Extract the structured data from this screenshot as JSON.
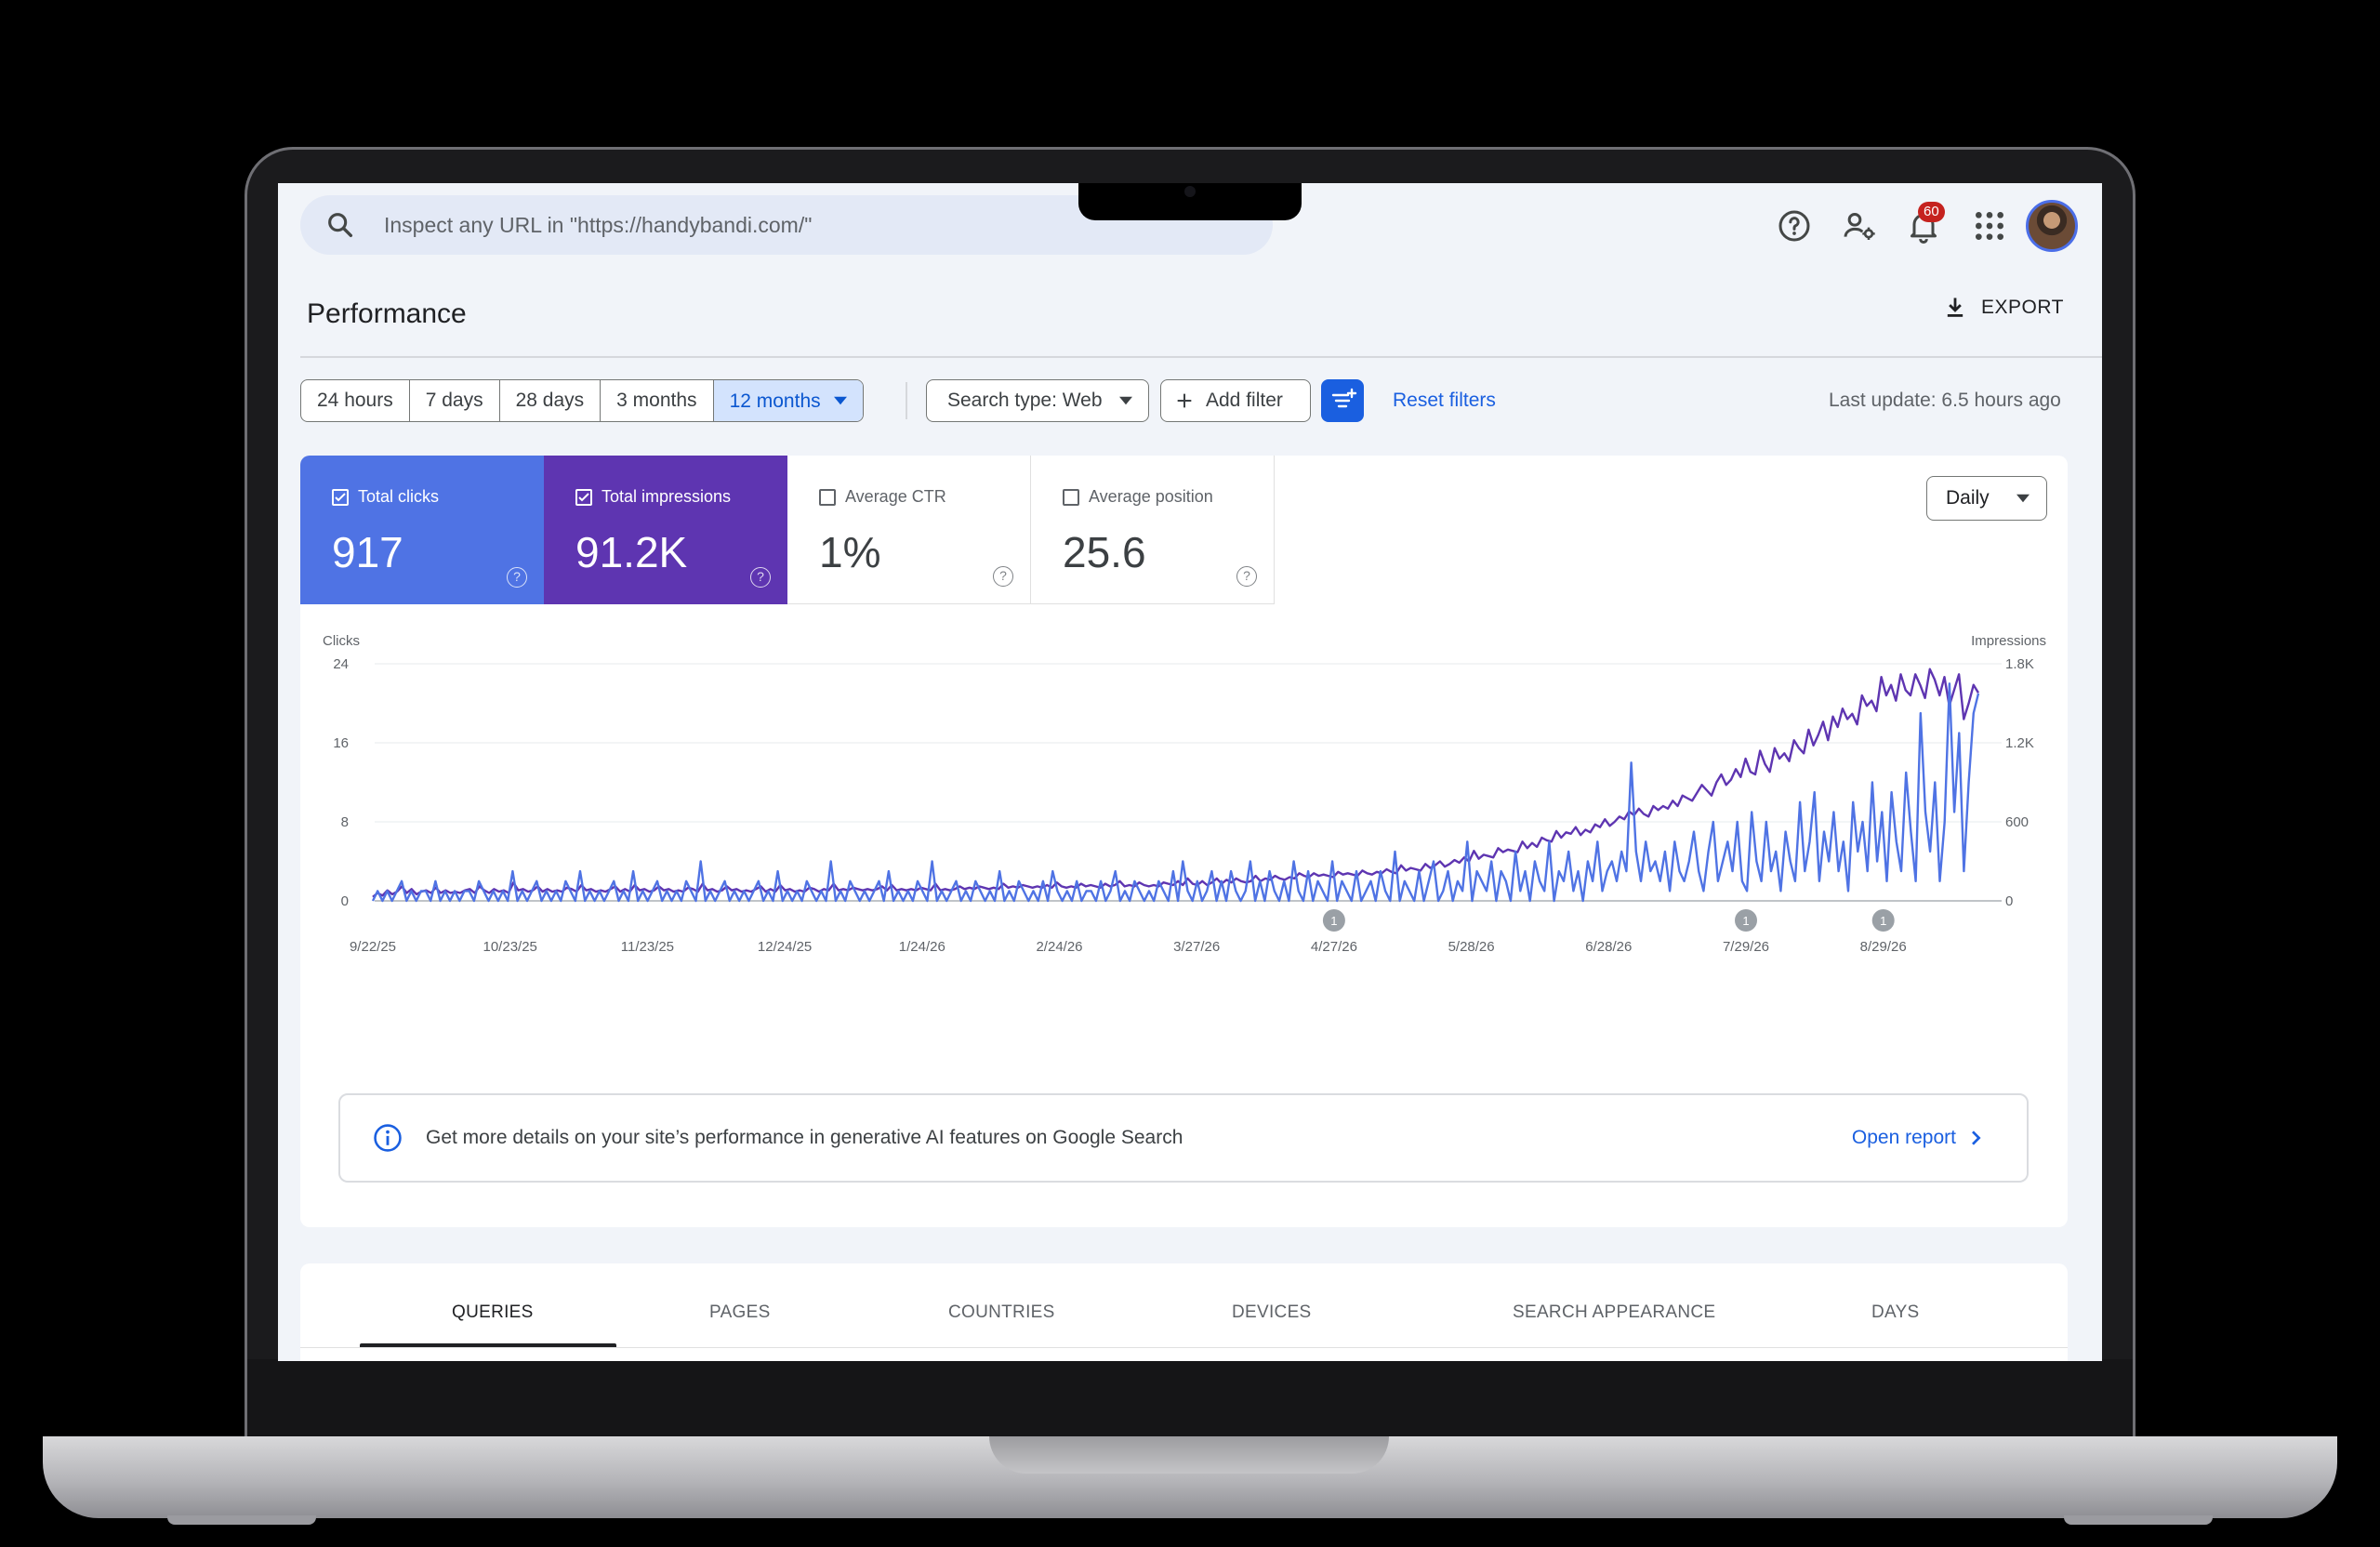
{
  "search": {
    "placeholder": "Inspect any URL in \"https://handybandi.com/\""
  },
  "topbar": {
    "notifications_count": "60"
  },
  "header": {
    "title": "Performance",
    "export_label": "EXPORT"
  },
  "filters": {
    "ranges": [
      "24 hours",
      "7 days",
      "28 days",
      "3 months",
      "12 months"
    ],
    "selected_range": "12 months",
    "search_type": "Search type: Web",
    "add_filter": "Add filter",
    "reset": "Reset filters",
    "last_update": "Last update: 6.5 hours ago"
  },
  "metrics": [
    {
      "label": "Total clicks",
      "value": "917",
      "checked": true,
      "color": "#4f73e4"
    },
    {
      "label": "Total impressions",
      "value": "91.2K",
      "checked": true,
      "color": "#5e35b1"
    },
    {
      "label": "Average CTR",
      "value": "1%",
      "checked": false
    },
    {
      "label": "Average position",
      "value": "25.6",
      "checked": false
    }
  ],
  "granularity": "Daily",
  "chart_data": {
    "type": "line",
    "left_axis_label": "Clicks",
    "right_axis_label": "Impressions",
    "left_ticks": [
      "24",
      "16",
      "8",
      "0"
    ],
    "right_ticks": [
      "1.8K",
      "1.2K",
      "600",
      "0"
    ],
    "ylim_left": [
      0,
      24
    ],
    "ylim_right": [
      0,
      1800
    ],
    "x_ticks": [
      "9/22/25",
      "10/23/25",
      "11/23/25",
      "12/24/25",
      "1/24/26",
      "2/24/26",
      "3/27/26",
      "4/27/26",
      "5/28/26",
      "6/28/26",
      "7/29/26",
      "8/29/26"
    ],
    "annotations": [
      {
        "date": "4/27/26",
        "label": "1"
      },
      {
        "date": "7/29/26",
        "label": "1"
      },
      {
        "date": "8/29/26",
        "label": "1"
      }
    ],
    "series": [
      {
        "name": "Clicks",
        "axis": "left",
        "color": "#4f73e4",
        "values": [
          0,
          1,
          0,
          1,
          0,
          1,
          2,
          0,
          1,
          0,
          1,
          1,
          0,
          2,
          0,
          1,
          0,
          1,
          0,
          1,
          1,
          0,
          2,
          1,
          0,
          1,
          0,
          1,
          0,
          3,
          0,
          1,
          0,
          1,
          2,
          0,
          1,
          0,
          1,
          0,
          2,
          1,
          0,
          3,
          0,
          1,
          0,
          1,
          0,
          1,
          2,
          0,
          1,
          0,
          3,
          0,
          1,
          0,
          1,
          2,
          0,
          1,
          0,
          1,
          0,
          2,
          1,
          0,
          4,
          0,
          1,
          0,
          1,
          2,
          0,
          1,
          0,
          1,
          0,
          1,
          2,
          0,
          1,
          0,
          3,
          0,
          1,
          0,
          1,
          0,
          2,
          1,
          0,
          1,
          0,
          4,
          0,
          1,
          0,
          2,
          1,
          0,
          1,
          0,
          1,
          2,
          0,
          3,
          0,
          1,
          0,
          1,
          0,
          2,
          1,
          0,
          4,
          0,
          1,
          0,
          1,
          2,
          0,
          1,
          0,
          2,
          1,
          0,
          1,
          0,
          3,
          0,
          1,
          0,
          2,
          1,
          0,
          1,
          0,
          2,
          0,
          3,
          1,
          0,
          1,
          0,
          2,
          0,
          1,
          1,
          0,
          2,
          0,
          1,
          3,
          0,
          1,
          0,
          2,
          1,
          0,
          1,
          0,
          2,
          1,
          0,
          3,
          0,
          4,
          1,
          0,
          2,
          0,
          1,
          3,
          0,
          2,
          0,
          3,
          1,
          0,
          1,
          4,
          0,
          2,
          0,
          3,
          1,
          0,
          2,
          0,
          4,
          1,
          0,
          3,
          0,
          2,
          1,
          0,
          4,
          0,
          2,
          1,
          0,
          3,
          0,
          1,
          2,
          0,
          3,
          1,
          0,
          5,
          0,
          2,
          1,
          0,
          3,
          0,
          2,
          4,
          0,
          1,
          3,
          0,
          2,
          1,
          6,
          0,
          3,
          2,
          1,
          4,
          0,
          3,
          2,
          0,
          5,
          1,
          3,
          0,
          4,
          2,
          1,
          6,
          0,
          3,
          2,
          5,
          1,
          3,
          0,
          4,
          2,
          6,
          1,
          3,
          4,
          2,
          5,
          3,
          14,
          5,
          2,
          6,
          3,
          4,
          2,
          5,
          1,
          6,
          3,
          2,
          4,
          7,
          3,
          1,
          5,
          8,
          2,
          4,
          6,
          3,
          8,
          2,
          1,
          9,
          4,
          2,
          8,
          3,
          5,
          1,
          7,
          4,
          2,
          10,
          3,
          6,
          11,
          2,
          7,
          4,
          9,
          3,
          6,
          1,
          10,
          5,
          8,
          3,
          12,
          4,
          9,
          2,
          11,
          6,
          3,
          13,
          7,
          2,
          19,
          9,
          5,
          12,
          2,
          8,
          22,
          9,
          17,
          3,
          12,
          19,
          21
        ]
      },
      {
        "name": "Impressions",
        "axis": "right",
        "color": "#5e35b1",
        "values": [
          30,
          60,
          40,
          80,
          50,
          70,
          110,
          60,
          90,
          50,
          70,
          80,
          60,
          100,
          60,
          80,
          60,
          70,
          60,
          80,
          90,
          60,
          110,
          80,
          60,
          90,
          70,
          80,
          60,
          140,
          80,
          90,
          70,
          80,
          110,
          70,
          90,
          70,
          80,
          70,
          100,
          90,
          70,
          120,
          80,
          90,
          70,
          80,
          70,
          90,
          110,
          70,
          90,
          70,
          120,
          80,
          90,
          70,
          80,
          110,
          80,
          90,
          70,
          80,
          70,
          100,
          90,
          70,
          130,
          80,
          90,
          70,
          80,
          110,
          80,
          90,
          70,
          80,
          70,
          90,
          110,
          70,
          90,
          70,
          120,
          80,
          90,
          70,
          80,
          70,
          100,
          90,
          70,
          90,
          80,
          130,
          80,
          90,
          80,
          100,
          90,
          80,
          90,
          80,
          90,
          110,
          80,
          120,
          80,
          90,
          80,
          90,
          80,
          100,
          90,
          80,
          130,
          80,
          90,
          80,
          90,
          110,
          90,
          100,
          90,
          110,
          100,
          90,
          100,
          90,
          130,
          100,
          110,
          100,
          120,
          110,
          100,
          110,
          100,
          120,
          100,
          140,
          110,
          100,
          110,
          100,
          130,
          110,
          120,
          110,
          100,
          130,
          110,
          120,
          150,
          110,
          120,
          110,
          140,
          120,
          110,
          120,
          110,
          140,
          130,
          120,
          150,
          120,
          170,
          130,
          120,
          150,
          120,
          140,
          170,
          130,
          160,
          140,
          170,
          150,
          140,
          150,
          190,
          150,
          170,
          160,
          190,
          170,
          160,
          180,
          170,
          210,
          190,
          180,
          210,
          190,
          200,
          190,
          180,
          220,
          200,
          210,
          200,
          190,
          230,
          210,
          200,
          220,
          210,
          240,
          220,
          210,
          270,
          230,
          250,
          240,
          230,
          280,
          250,
          270,
          300,
          260,
          280,
          310,
          290,
          330,
          300,
          380,
          320,
          350,
          340,
          330,
          400,
          370,
          390,
          380,
          370,
          450,
          400,
          440,
          410,
          480,
          460,
          450,
          530,
          480,
          520,
          510,
          560,
          500,
          540,
          520,
          580,
          560,
          620,
          570,
          600,
          640,
          620,
          680,
          650,
          700,
          660,
          640,
          720,
          690,
          720,
          700,
          760,
          720,
          800,
          780,
          760,
          820,
          880,
          840,
          800,
          900,
          960,
          880,
          920,
          1000,
          940,
          1080,
          980,
          960,
          1140,
          1040,
          980,
          1160,
          1080,
          1120,
          1060,
          1220,
          1160,
          1120,
          1300,
          1180,
          1260,
          1360,
          1220,
          1400,
          1320,
          1460,
          1380,
          1420,
          1340,
          1560,
          1480,
          1520,
          1440,
          1700,
          1560,
          1640,
          1520,
          1720,
          1600,
          1560,
          1720,
          1640,
          1540,
          1760,
          1680,
          1560,
          1700,
          1480,
          1600,
          1720,
          1380,
          1500,
          1640,
          1580
        ]
      }
    ]
  },
  "info_banner": {
    "text": "Get more details on your site’s performance in generative AI features on Google Search",
    "link": "Open report"
  },
  "tabs": [
    "QUERIES",
    "PAGES",
    "COUNTRIES",
    "DEVICES",
    "SEARCH APPEARANCE",
    "DAYS"
  ],
  "active_tab": "QUERIES"
}
